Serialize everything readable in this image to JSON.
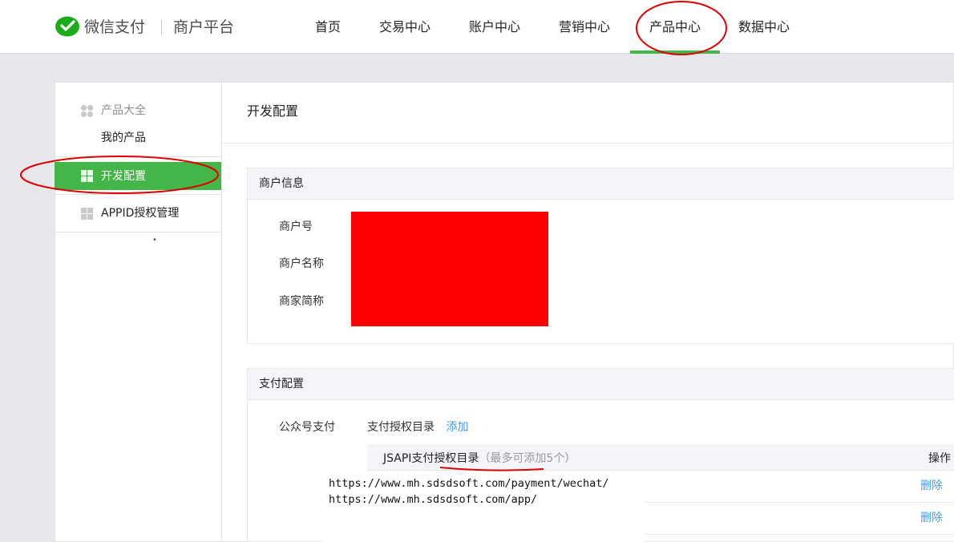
{
  "header": {
    "brand_name": "微信支付",
    "brand_sub": "商户平台",
    "nav": [
      {
        "label": "首页"
      },
      {
        "label": "交易中心"
      },
      {
        "label": "账户中心"
      },
      {
        "label": "营销中心"
      },
      {
        "label": "产品中心",
        "active": true
      },
      {
        "label": "数据中心"
      }
    ]
  },
  "sidebar": {
    "group_title": "产品大全",
    "my_products": "我的产品",
    "dev_config": "开发配置",
    "appid_manage": "APPID授权管理"
  },
  "main": {
    "page_title": "开发配置",
    "merchant_info": {
      "title": "商户信息",
      "fields": [
        "商户号",
        "商户名称",
        "商家简称"
      ]
    },
    "pay_config": {
      "title": "支付配置",
      "label": "公众号支付",
      "dir_label": "支付授权目录",
      "add_link": "添加",
      "table_header": "JSAPI支付授权目录",
      "table_hint": "（最多可添加5个）",
      "action_header": "操作",
      "urls": [
        "https://www.mh.sdsdsoft.com/payment/wechat/",
        "https://www.mh.sdsdsoft.com/app/"
      ],
      "delete_label": "删除"
    }
  },
  "colors": {
    "accent": "#44b549",
    "link": "#459ae9",
    "annotation": "#e00000",
    "redaction": "#ff0000"
  }
}
